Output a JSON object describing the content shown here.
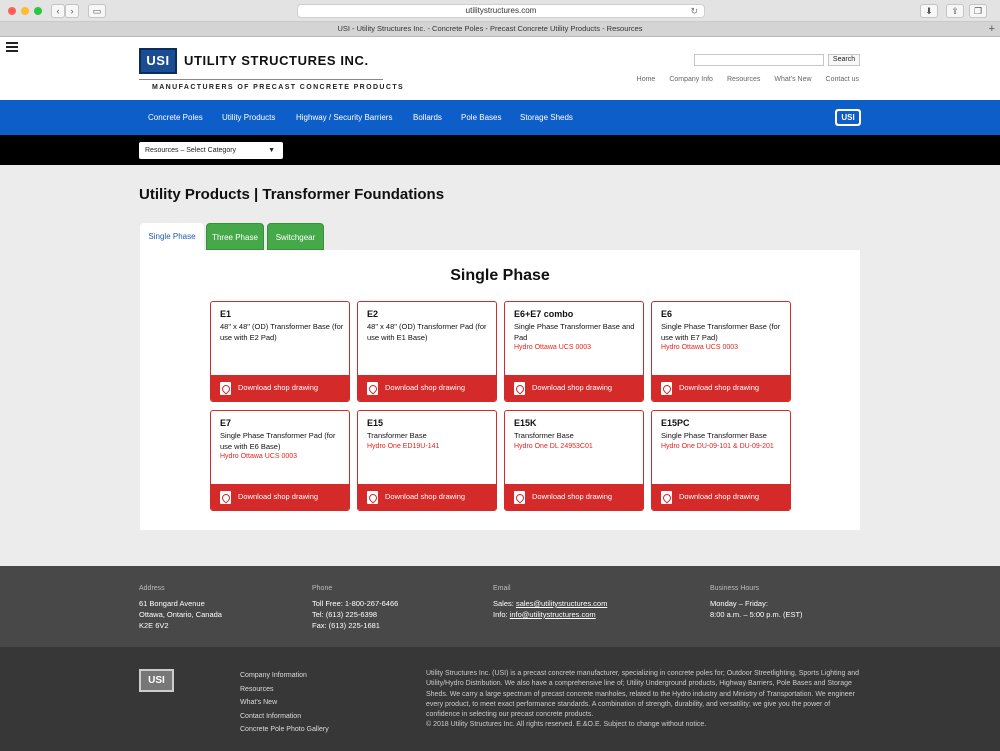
{
  "browser": {
    "url": "utilitystructures.com",
    "tab_title": "USI - Utility Structures Inc. - Concrete Poles - Precast Concrete Utility Products - Resources",
    "back": "‹",
    "forward": "›",
    "new_tab": "+",
    "light_colors": [
      "#fe5f57",
      "#febc2e",
      "#28c840"
    ]
  },
  "header": {
    "logo_text": "USI",
    "company_name": "UTILITY STRUCTURES INC.",
    "tagline": "MANUFACTURERS OF PRECAST CONCRETE PRODUCTS",
    "search_placeholder": "",
    "search_button": "Search",
    "links": [
      "Home",
      "Company Info",
      "Resources",
      "What's New",
      "Contact us"
    ]
  },
  "nav": {
    "items": [
      "Concrete Poles",
      "Utility Products",
      "Highway / Security Barriers",
      "Bollards",
      "Pole Bases",
      "Storage Sheds"
    ],
    "logo_text": "USI"
  },
  "resources_select": "Resources – Select Category",
  "page_title": "Utility Products | Transformer Foundations",
  "tabs": [
    "Single Phase",
    "Three Phase",
    "Switchgear"
  ],
  "panel_title": "Single Phase",
  "download_label": "Download shop drawing",
  "products": [
    {
      "code": "E1",
      "desc": "48\" x 48\" (OD) Transformer Base (for use with E2 Pad)",
      "ref": ""
    },
    {
      "code": "E2",
      "desc": "48\" x 48\" (OD) Transformer Pad (for use with E1 Base)",
      "ref": ""
    },
    {
      "code": "E6+E7 combo",
      "desc": "Single Phase Transformer Base and Pad",
      "ref": "Hydro Ottawa UCS 0003"
    },
    {
      "code": "E6",
      "desc": "Single Phase Transformer Base (for use with E7 Pad)",
      "ref": "Hydro Ottawa UCS 0003"
    },
    {
      "code": "E7",
      "desc": "Single Phase Transformer Pad (for use with E6 Base)",
      "ref": "Hydro Ottawa UCS 0003"
    },
    {
      "code": "E15",
      "desc": "Transformer Base",
      "ref": "Hydro One ED19U-141"
    },
    {
      "code": "E15K",
      "desc": "Transformer Base",
      "ref": "Hydro One DL 24953C01"
    },
    {
      "code": "E15PC",
      "desc": "Single Phase Transformer Base",
      "ref": "Hydro One DU-09-101 & DU-09-201"
    }
  ],
  "footer": {
    "address_label": "Address",
    "address_lines": [
      "61 Bongard Avenue",
      "Ottawa, Ontario, Canada",
      "K2E 6V2"
    ],
    "phone_label": "Phone",
    "phone_lines": [
      "Toll Free: 1-800-267-6466",
      "Tel: (613) 225-6398",
      "Fax: (613) 225-1681"
    ],
    "email_label": "Email",
    "email_sales_prefix": "Sales: ",
    "email_sales": "sales@utilitystructures.com",
    "email_info_prefix": "Info: ",
    "email_info": "info@utilitystructures.com",
    "hours_label": "Business Hours",
    "hours_lines": [
      "Monday – Friday:",
      "8:00 a.m. – 5:00 p.m. (EST)"
    ],
    "logo_text": "USI",
    "links": [
      "Company Information",
      "Resources",
      "What's New",
      "Contact Information",
      "Concrete Pole Photo Gallery"
    ],
    "about": "Utility Structures Inc. (USI) is a precast concrete manufacturer, specializing in concrete poles for; Outdoor Streetlighting, Sports Lighting and Utility/Hydro Distribution. We also have a comprehensive line of; Utility Underground products, Highway Barriers, Pole Bases and Storage Sheds. We carry a large spectrum of precast concrete manholes, related to the Hydro industry and Ministry of Transportation. We engineer every product, to meet exact performance standards. A combination of strength, durability, and versatility; we give you the power of confidence in selecting our precast concrete products.",
    "copyright": "© 2018 Utility Structures Inc. All rights reserved. E.&O.E. Subject to change without notice."
  }
}
